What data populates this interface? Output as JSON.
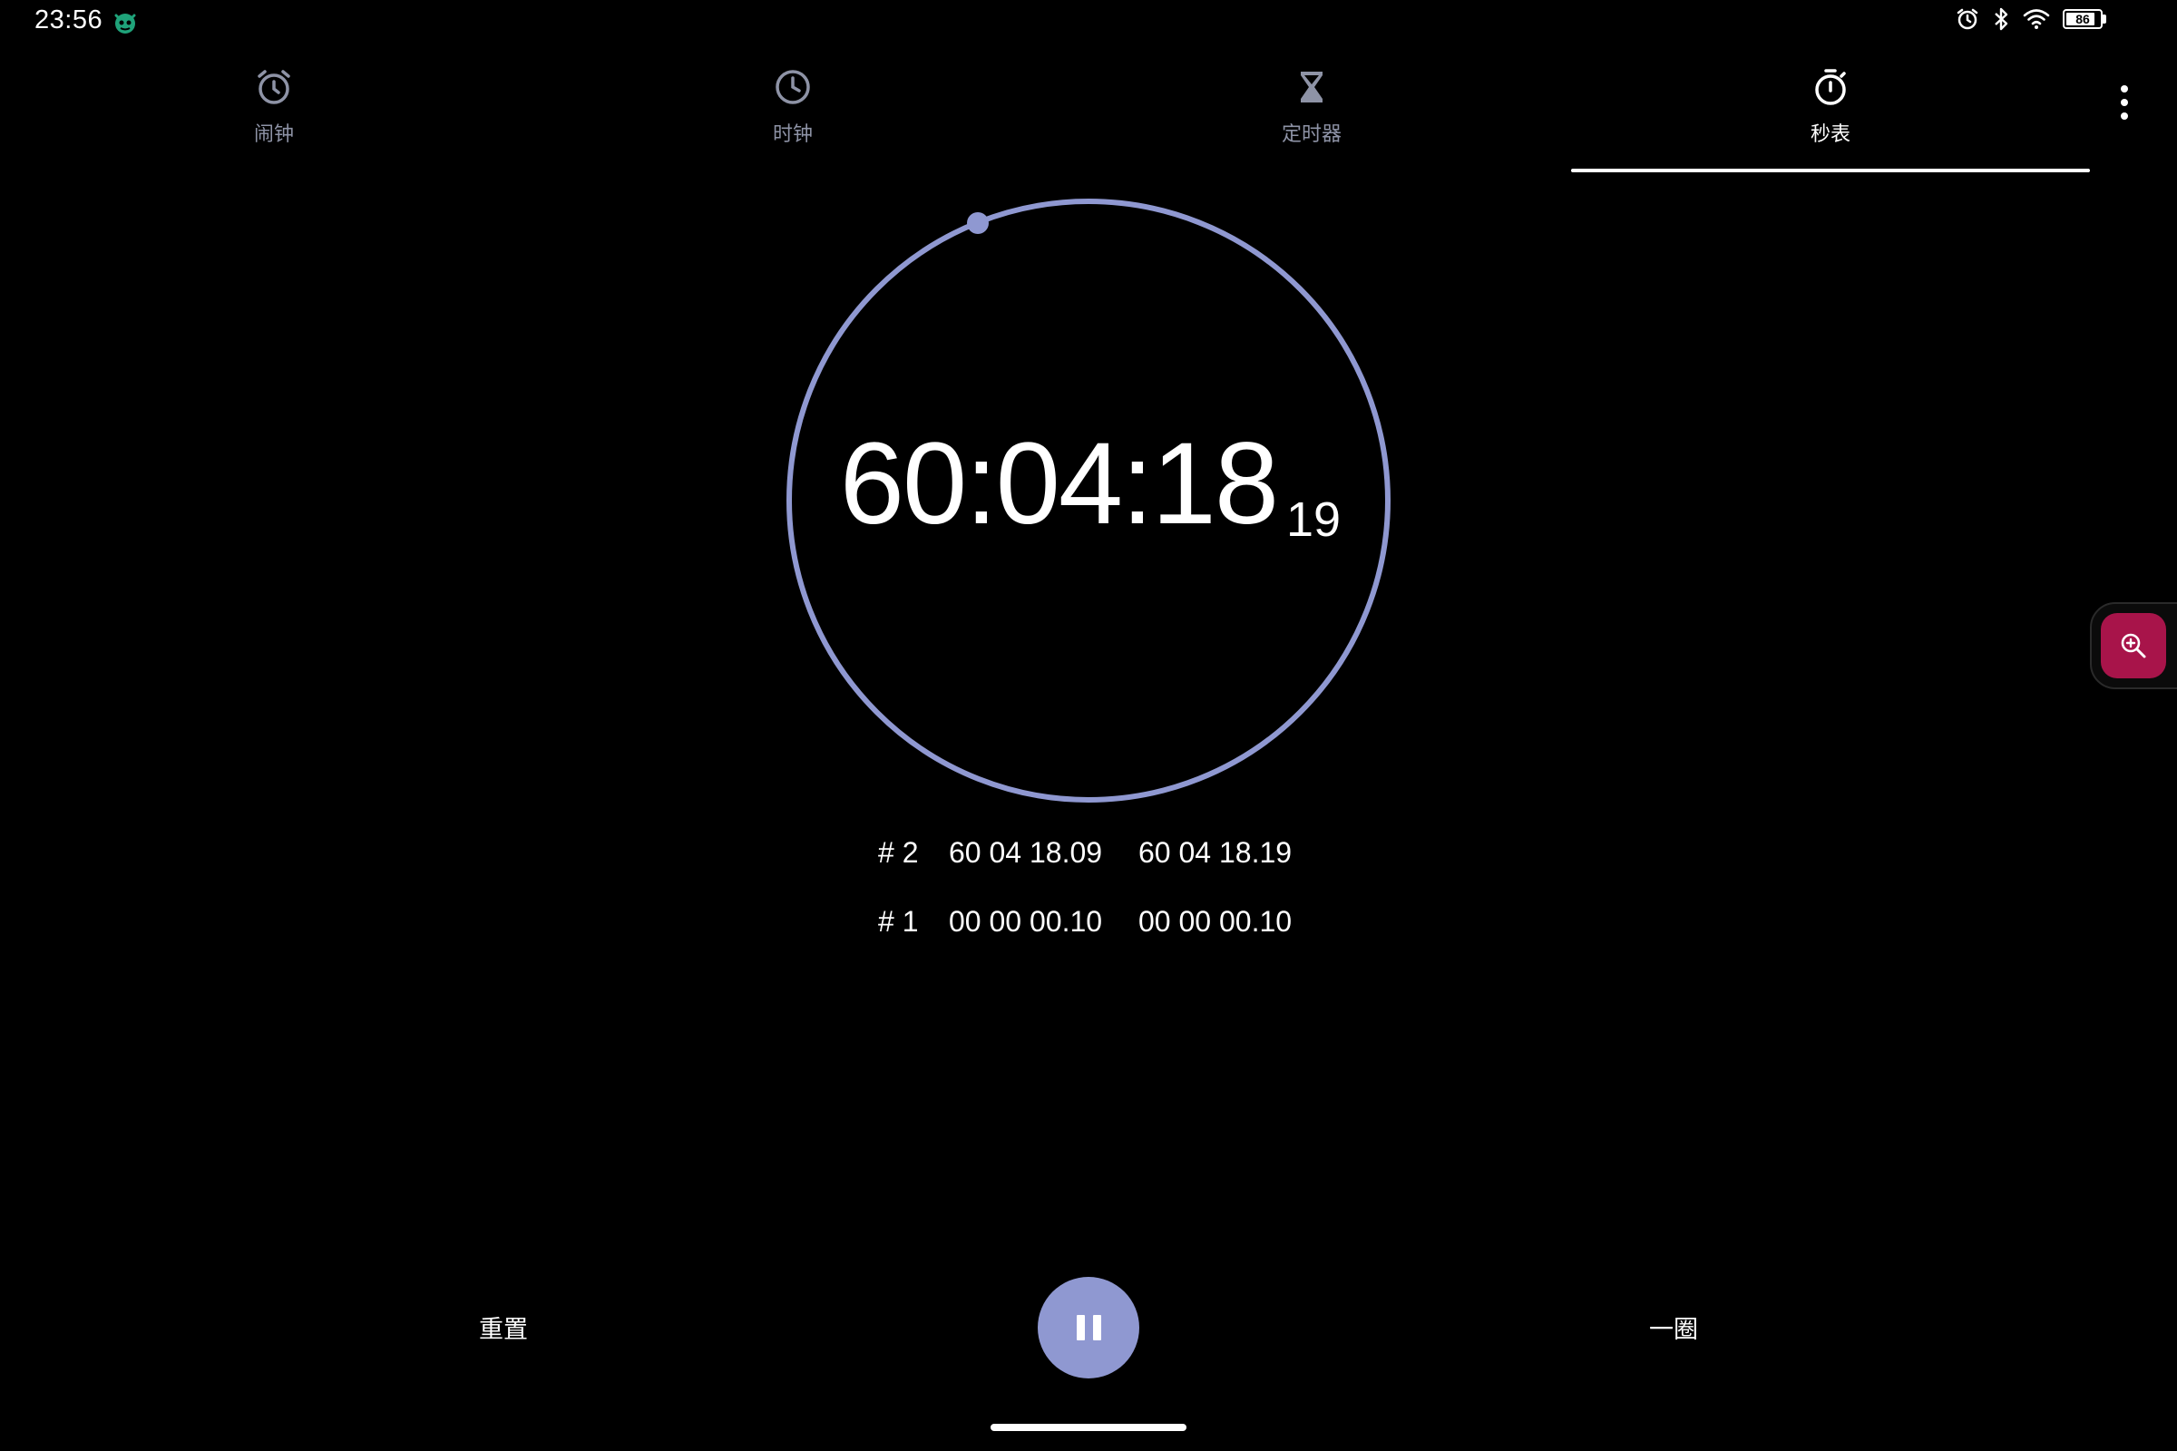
{
  "status_bar": {
    "time": "23:56",
    "battery_level": "86",
    "battery_fraction": 0.86
  },
  "tabs": [
    {
      "label": "闹钟",
      "icon": "alarm-icon",
      "active": false
    },
    {
      "label": "时钟",
      "icon": "clock-icon",
      "active": false
    },
    {
      "label": "定时器",
      "icon": "hourglass-icon",
      "active": false
    },
    {
      "label": "秒表",
      "icon": "stopwatch-icon",
      "active": true
    }
  ],
  "stopwatch": {
    "time_main": "60:04:18",
    "time_hundredths": "19"
  },
  "laps": [
    {
      "number": "# 2",
      "lap_time": "60 04 18.09",
      "total_time": "60 04 18.19"
    },
    {
      "number": "# 1",
      "lap_time": "00 00 00.10",
      "total_time": "00 00 00.10"
    }
  ],
  "controls": {
    "reset_label": "重置",
    "lap_label": "一圈"
  },
  "colors": {
    "background": "#000000",
    "accent": "#8f98d1",
    "ring": "#8f98d1",
    "inactive_tab": "#8e93a6",
    "zoom_button": "#a8144a"
  }
}
